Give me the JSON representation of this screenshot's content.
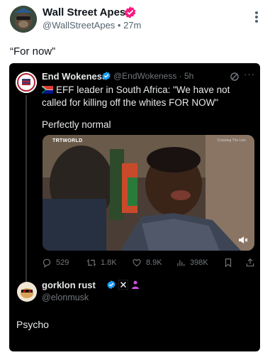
{
  "post": {
    "author_name": "Wall Street Apes",
    "author_meta": "@WallStreetApes • 27m",
    "text": "“For now”"
  },
  "quote": {
    "author_name": "End Wokeness",
    "author_meta": "@EndWokeness · 5h",
    "more": "···",
    "body_text": "EFF leader in South Africa: \"We have not called for killing off the whites FOR NOW\"",
    "body_text2": "Perfectly normal",
    "media": {
      "logo": "TRTWORLD",
      "caption": "Crossing The Line"
    },
    "stats": {
      "replies": "529",
      "reposts": "1.8K",
      "likes": "8.9K",
      "views": "398K"
    }
  },
  "reply": {
    "author_name": "gorklon rust",
    "handle": "@elonmusk",
    "text": "Psycho"
  },
  "colors": {
    "verified_pink": "#f91880",
    "verified_blue": "#1d9bf0",
    "quote_bg": "#000000",
    "muted": "#71767b"
  }
}
